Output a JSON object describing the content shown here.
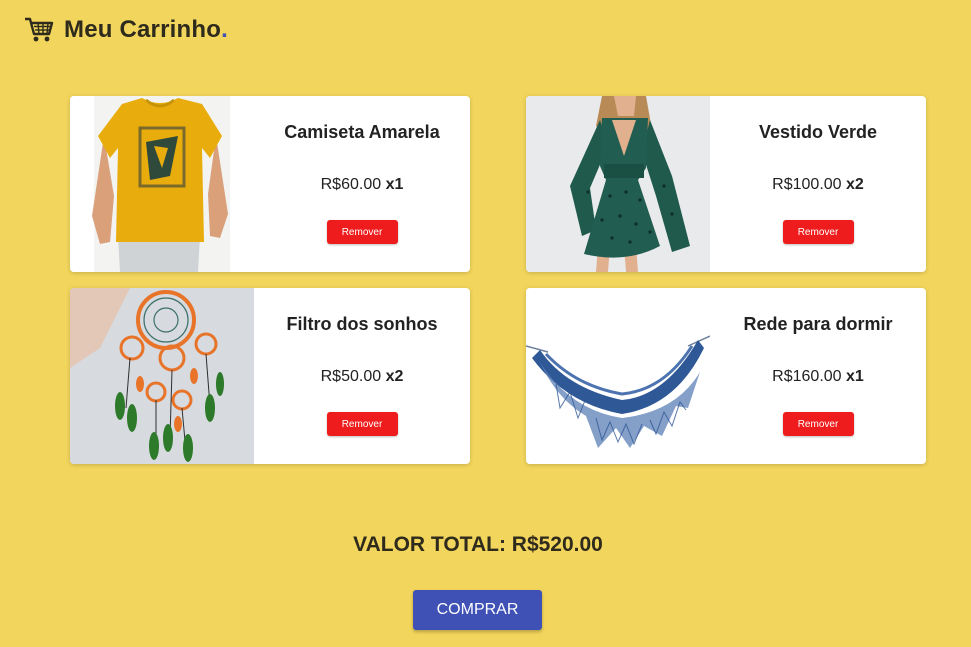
{
  "header": {
    "title": "Meu Carrinho",
    "title_dot": ".",
    "icon": "shopping-cart-icon"
  },
  "products": [
    {
      "name": "Camiseta Amarela",
      "price": "R$60.00",
      "qty": "x1",
      "remove_label": "Remover",
      "image": "yellow-tshirt-photo"
    },
    {
      "name": "Vestido Verde",
      "price": "R$100.00",
      "qty": "x2",
      "remove_label": "Remover",
      "image": "green-dress-photo"
    },
    {
      "name": "Filtro dos sonhos",
      "price": "R$50.00",
      "qty": "x2",
      "remove_label": "Remover",
      "image": "dreamcatcher-photo"
    },
    {
      "name": "Rede para dormir",
      "price": "R$160.00",
      "qty": "x1",
      "remove_label": "Remover",
      "image": "hammock-photo"
    }
  ],
  "total": {
    "label": "VALOR TOTAL: R$520.00"
  },
  "buy_label": "COMPRAR",
  "colors": {
    "background": "#f2d55c",
    "accent": "#3f51b5",
    "remove": "#ee1c1c"
  }
}
